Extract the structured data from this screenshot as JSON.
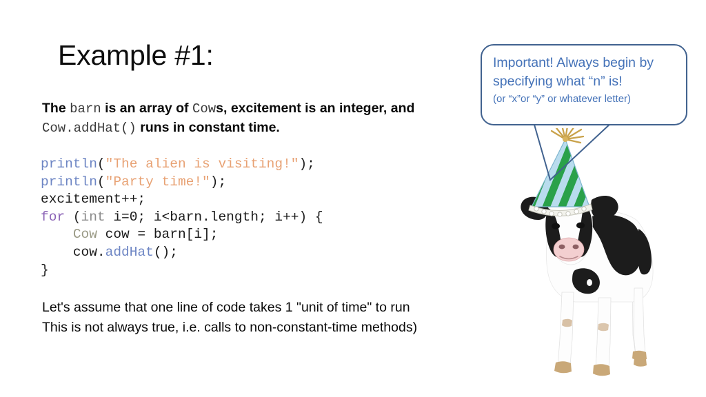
{
  "slide": {
    "title": "Example #1:",
    "intro": {
      "seg1": "The ",
      "code1": "barn",
      "seg2": " is an array of ",
      "code2": "Cow",
      "seg3": "s, excitement is an integer, and ",
      "code3": "Cow.addHat()",
      "seg4": " runs in constant time."
    },
    "code": {
      "line1": {
        "fn": "println",
        "open": "(",
        "str": "\"The alien is visiting!\"",
        "close": ");"
      },
      "line2": {
        "fn": "println",
        "open": "(",
        "str": "\"Party time!\"",
        "close": ");"
      },
      "line3": "excitement++;",
      "line4": {
        "kw": "for",
        "rest1": " (",
        "prim": "int",
        "rest2": " i=0; i<barn.length; i++) {"
      },
      "line5": {
        "indent": "    ",
        "type": "Cow",
        "rest": " cow = barn[i];"
      },
      "line6": {
        "indent": "    ",
        "pre": "cow.",
        "fn": "addHat",
        "post": "();"
      },
      "line7": "}"
    },
    "note": {
      "line1": "Let's assume that one line of code takes 1 \"unit of time\" to run",
      "line2": "This is not always true, i.e. calls to non-constant-time methods)"
    }
  },
  "callout": {
    "line1": "Important! Always begin",
    "line2": "by specifying what “n” is!",
    "line3": "(or “x”or “y” or whatever letter)",
    "border_color": "#41628f",
    "text_color": "#4472b8"
  },
  "figure": {
    "name": "cow-with-party-hat",
    "hat_stripe_green": "#2aa14a",
    "hat_stripe_blue": "#b9dcee",
    "tassel_color": "#c9a24a",
    "cow_body": "#ffffff",
    "cow_spots": "#1c1c1c"
  },
  "syntax_colors": {
    "function": "#6e86c4",
    "string": "#e8a274",
    "keyword": "#8a62b5",
    "type": "#9a9a86",
    "primitive": "#8c8c8c",
    "plain": "#1a1a1a"
  }
}
